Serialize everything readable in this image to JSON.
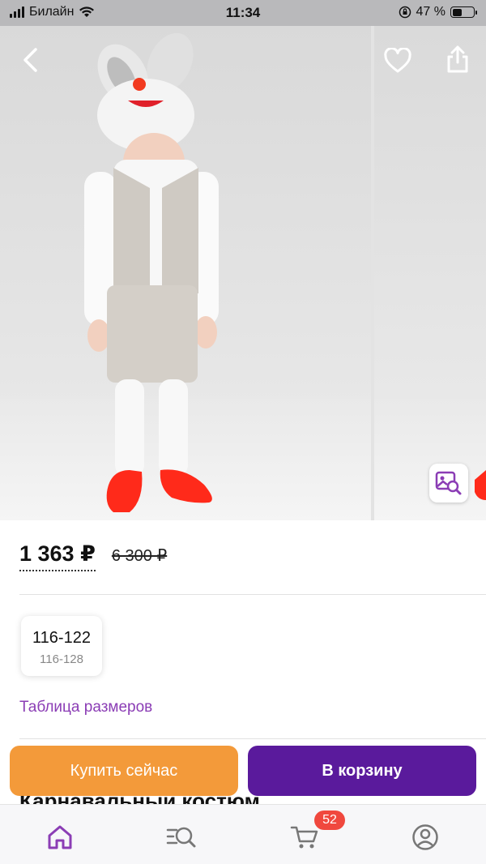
{
  "status_bar": {
    "carrier": "Билайн",
    "time": "11:34",
    "battery": "47 %",
    "battery_level": 0.47
  },
  "gallery": {
    "back_icon": "chevron-left-icon",
    "favorite_icon": "heart-icon",
    "share_icon": "share-icon",
    "visual_search_icon": "image-search-icon"
  },
  "product": {
    "price": "1 363 ₽",
    "old_price": "6 300 ₽",
    "size_primary": "116-122",
    "size_secondary": "116-128",
    "size_table_link": "Таблица размеров",
    "title_peek": "Карнавальный костюм"
  },
  "actions": {
    "buy_now": "Купить сейчас",
    "add_to_cart": "В корзину"
  },
  "tabbar": {
    "items": [
      {
        "icon": "home-icon",
        "active": true
      },
      {
        "icon": "catalog-search-icon",
        "active": false
      },
      {
        "icon": "cart-icon",
        "active": false
      },
      {
        "icon": "profile-icon",
        "active": false
      }
    ],
    "cart_badge": "52"
  },
  "colors": {
    "accent": "#8b3db5",
    "buy": "#f39a3a",
    "cart": "#5a1a9c",
    "badge": "#f0483e"
  }
}
